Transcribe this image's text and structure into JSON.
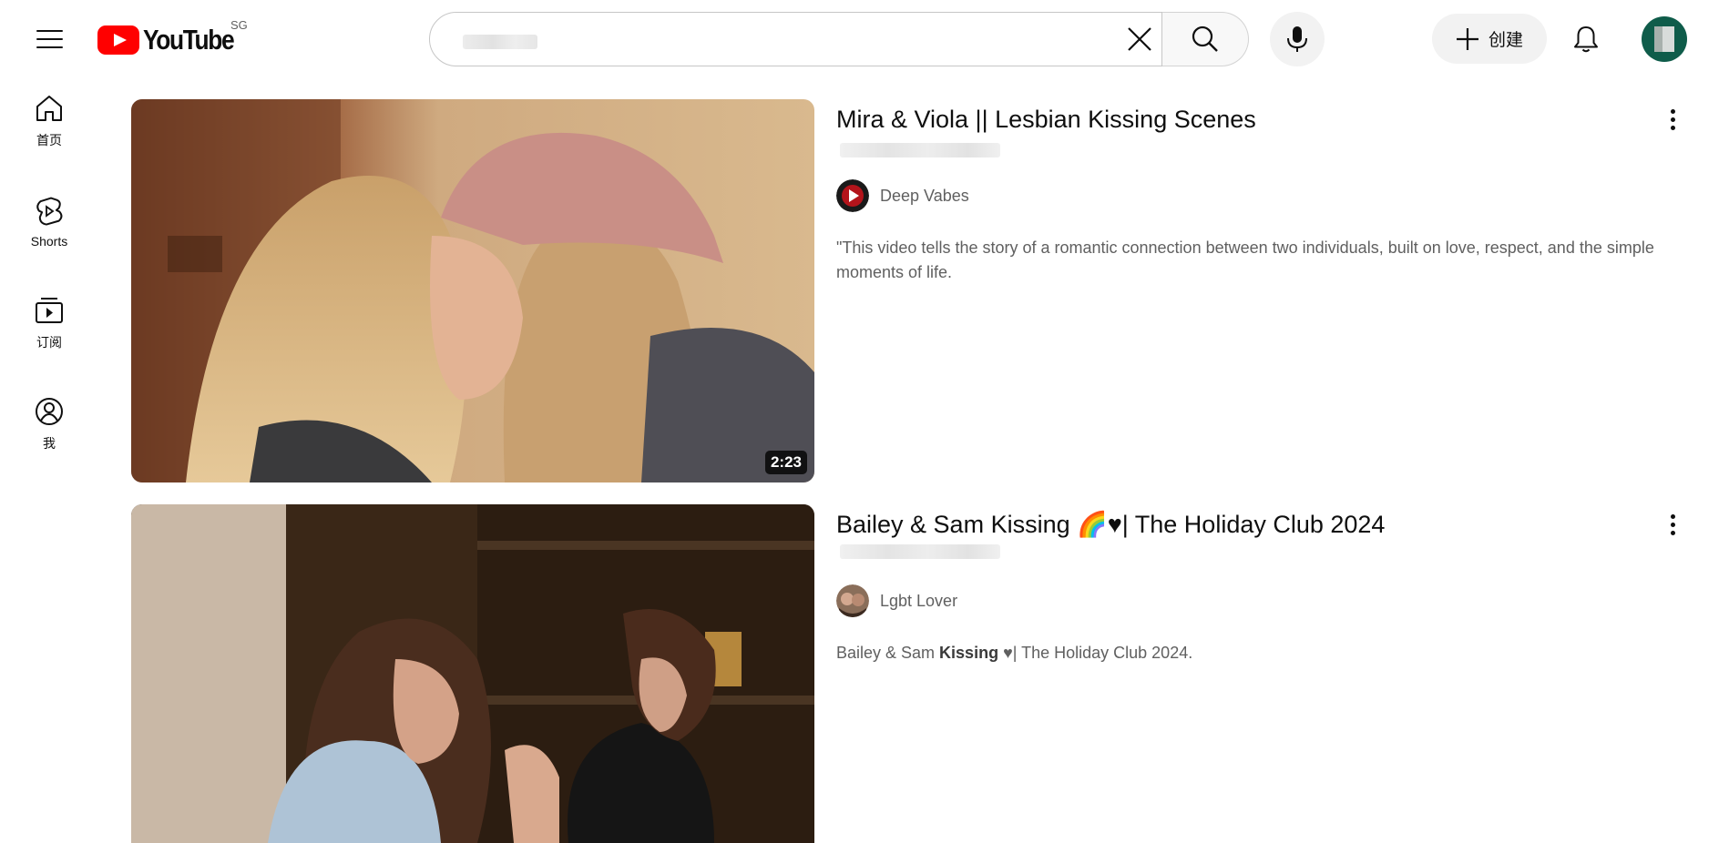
{
  "header": {
    "logo_text": "YouTube",
    "region": "SG",
    "search": {
      "value": "",
      "placeholder": ""
    },
    "create_label": "创建"
  },
  "rail": [
    {
      "label": "首页",
      "icon": "home-icon"
    },
    {
      "label": "Shorts",
      "icon": "shorts-icon"
    },
    {
      "label": "订阅",
      "icon": "subscriptions-icon"
    },
    {
      "label": "我",
      "icon": "you-icon"
    }
  ],
  "results": [
    {
      "title": "Mira & Viola || Lesbian Kissing Scenes",
      "duration": "2:23",
      "channel": "Deep Vabes",
      "description": "\"This video tells the story of a romantic connection between two individuals, built on love, respect, and the simple moments of life."
    },
    {
      "title": "Bailey & Sam Kissing 🌈♥| The Holiday Club 2024",
      "channel": "Lgbt Lover",
      "description_parts": [
        "Bailey & Sam ",
        "Kissing",
        " ♥| The Holiday Club 2024."
      ]
    }
  ],
  "colors": {
    "brand_red": "#ff0000",
    "text_primary": "#0f0f0f",
    "text_secondary": "#606060",
    "chip_bg": "#f2f2f2"
  }
}
